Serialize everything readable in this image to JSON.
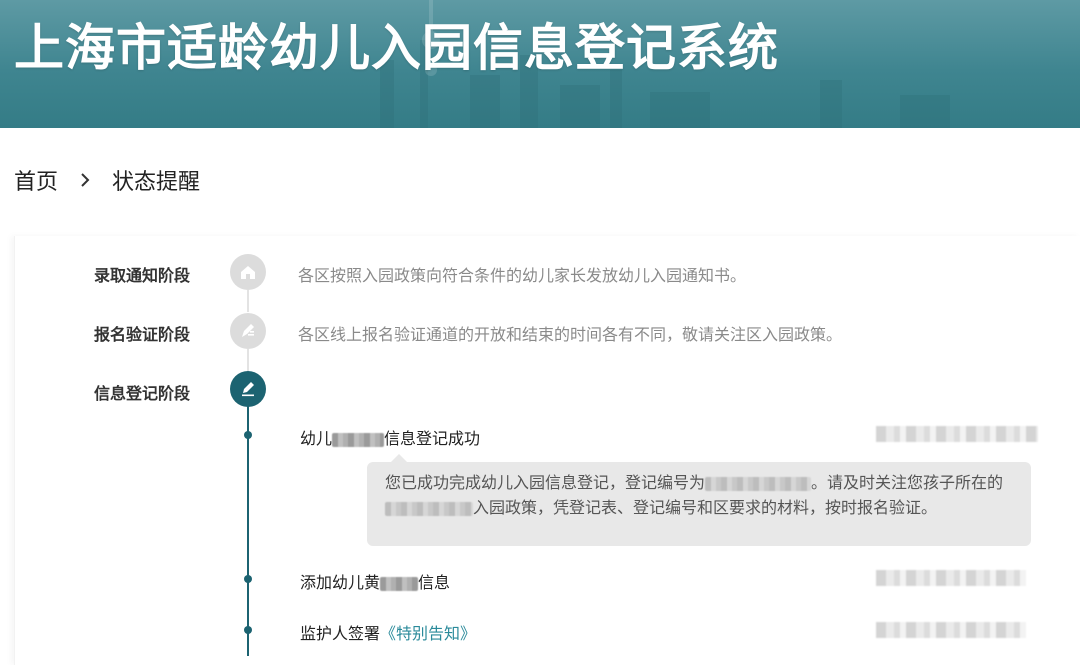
{
  "header": {
    "title": "上海市适龄幼儿入园信息登记系统"
  },
  "breadcrumb": {
    "home": "首页",
    "current": "状态提醒"
  },
  "stages": [
    {
      "label": "录取通知阶段",
      "desc": "各区按照入园政策向符合条件的幼儿家长发放幼儿入园通知书。",
      "icon": "home-icon",
      "state": "inactive"
    },
    {
      "label": "报名验证阶段",
      "desc": "各区线上报名验证通道的开放和结束的时间各有不同，敬请关注区入园政策。",
      "icon": "document-edit-icon",
      "state": "inactive"
    },
    {
      "label": "信息登记阶段",
      "desc": "",
      "icon": "pen-icon",
      "state": "active"
    }
  ],
  "steps": {
    "register_success": {
      "prefix": "幼儿",
      "suffix": "信息登记成功"
    },
    "notice": {
      "part1": "您已成功完成幼儿入园信息登记，登记编号为",
      "part2": "。请及时关注您孩子所在的",
      "part3": "入园政策，凭登记表、登记编号和区要求的材料，按时报名验证。"
    },
    "add_child": {
      "prefix": "添加幼儿黄",
      "suffix": "信息"
    },
    "guardian_sign": {
      "prefix": "监护人签署",
      "link": "《特别告知》"
    }
  },
  "colors": {
    "banner": "#3f8590",
    "active": "#1c6371",
    "link": "#2a8a9a"
  }
}
